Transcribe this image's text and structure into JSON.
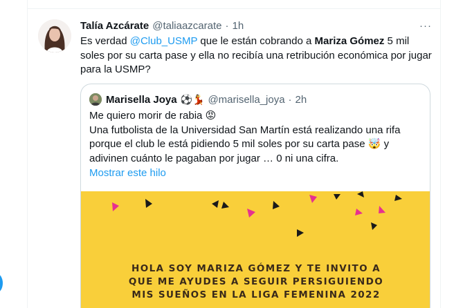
{
  "tweet": {
    "author_name": "Talía Azcárate",
    "handle": "@taliaazcarate",
    "separator": "·",
    "time": "1h",
    "more": "···",
    "text": {
      "part1": "Es verdad ",
      "mention": "@Club_USMP",
      "part2": " que le están cobrando a ",
      "bold_name": "Mariza Gómez",
      "part3": " 5 mil soles por su carta pase y ella no recibía una retribución económica por jugar para la USMP?"
    }
  },
  "quoted": {
    "author_name": "Marisella Joya",
    "emojis": "⚽💃",
    "handle": "@marisella_joya",
    "separator": "·",
    "time": "2h",
    "line1": "Me quiero morir de rabia 😡",
    "line2": "Una futbolista de la Universidad San Martín está realizando una rifa porque el club le está pidiendo 5 mil soles por su carta pase 🤯 y adivinen cuánto le pagaban por jugar … 0 ni una cifra.",
    "show_thread": "Mostrar este hilo",
    "image_text": [
      "HOLA SOY MARIZA GÓMEZ Y TE INVITO A",
      "QUE ME AYUDES A SEGUIR PERSIGUIENDO",
      "MIS SUEÑOS EN LA LIGA FEMENINA 2022"
    ]
  },
  "colors": {
    "accent": "#1d9bf0",
    "image_bg": "#f9cf3a",
    "confetti_pink": "#e6318f",
    "confetti_dark": "#1a1a1a"
  }
}
